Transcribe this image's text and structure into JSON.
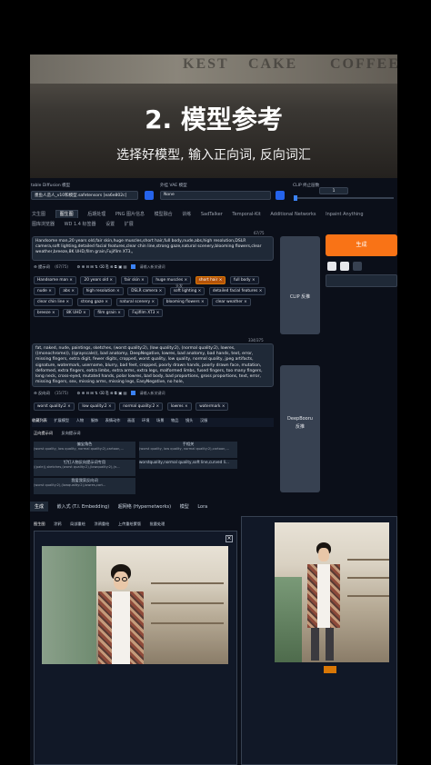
{
  "hero": {
    "sign_left": "KEST",
    "sign_mid": "CAKE",
    "sign_right": "COFFEE",
    "title": "2. 模型参考",
    "subtitle": "选择好模型, 输入正向词, 反向词汇"
  },
  "top": {
    "model_label": "table Diffusion 模型",
    "model_value": "墨鱼人造人_v10和模型.safetensors [ea6e802c]",
    "vae_label": "外挂 VAE 模型",
    "vae_value": "None",
    "clip_label": "CLIP 终止层数",
    "clip_value": "1"
  },
  "main_tabs": [
    "文生图",
    "图生图",
    "后期处理",
    "PNG 图片信息",
    "模型融合",
    "训练",
    "SadTalker",
    "Temporal-Kit",
    "Additional Networks",
    "Inpaint Anything"
  ],
  "main_tabs_row2": [
    "图库浏览器",
    "WD 1.4 标签器",
    "设置",
    "扩展"
  ],
  "prompt": {
    "text": "Handsome man,20 years old,fair skin,huge muscles,short hair,full body,nude,abs,high resolution,DSLR camera,soft lighting,detailed facial features,clear chin line,strong gaze,natural scenery,blooming flowers,clear weather,breeze,8K UHD,film grain,Fujifilm XT3,,",
    "counter": "67/75",
    "tags_label": "提示词",
    "tags_count": "(67/75)",
    "input_placeholder": "请输入新关键词",
    "tags": [
      "Handsome man",
      "20 years old",
      "fair skin",
      "huge muscles",
      "short hair",
      "full body",
      "nude",
      "abs",
      "high resolution",
      "DSLR camera",
      "soft lighting",
      "detailed facial features",
      "clear chin line",
      "strong gaze",
      "natural scenery",
      "blooming flowers",
      "clear weather",
      "breeze",
      "8K UHD",
      "film grain",
      "Fujifilm XT3"
    ],
    "highlight_tag": "short hair",
    "highlight_note": "头发"
  },
  "negative": {
    "text": "fat, naked, nude, paintings, sketches, (worst quality:2), (low quality:2), (normal quality:2), lowres, ((monochrome)), ((grayscale)), bad anatomy, DeepNegative, lowres, bad anatomy, bad hands, text, error, missing fingers, extra digit, fewer digits, cropped, worst quality, low quality, normal quality, jpeg artifacts, signature, watermark, username, blurry, bad feet, cropped, poorly drawn hands, poorly drawn face, mutation, deformed, extra fingers, extra limbs, extra arms, extra legs, malformed limbs, fused fingers, too many fingers, long neck, cross-eyed, mutated hands, polar lowres, bad body, bad proportions, gross proportions, text, error, missing fingers, sex, missing arms, missing legs, EasyNegative, no hole,",
    "counter": "334/375",
    "tags_label": "反向词",
    "tags_count": "(15/75)",
    "input_placeholder": "请输入新关键词",
    "tags": [
      "worst quality:2",
      "low quality:2",
      "normal quality:2",
      "lowres",
      "watermark"
    ]
  },
  "right": {
    "generate": "生成",
    "clip_button": "CLIP 反推",
    "deepbooru_button": "DeepBooru\n反推"
  },
  "category_tabs": [
    "收藏列表",
    "扩展模型",
    "人物",
    "服饰",
    "表情动作",
    "画面",
    "环境",
    "场景",
    "物品",
    "镜头",
    "汉服"
  ],
  "sub_tabs": [
    "正向提示词",
    "反向提示词"
  ],
  "presets": {
    "c1_title": "偏宝角色",
    "c1_desc": "(worst quality, low quality, normal quality:2),cartoon,...",
    "c2_title": "手相关",
    "c2_desc": "(worst quality, low quality, normal quality:2),cartoon,...",
    "c3_title": "钉钉人物反向提示词专用",
    "c3_desc": "((pale)),sketches,(worst quality:2),(lowquality:2),(n...",
    "c4_desc": "worstquality,normal quality,soft line,curved li...",
    "c5_title": "我爱我家反向词",
    "c5_desc": "(worst quality:2),(lowquality:2),lowres,cart..."
  },
  "bottom_tabs": [
    "生成",
    "嵌入式 (T.I. Embedding)",
    "超网络 (Hypernetworks)",
    "模型",
    "Lora"
  ],
  "img_tabs": [
    "图生图",
    "涂鸦",
    "局部重绘",
    "涂鸦重绘",
    "上传重绘蒙版",
    "批量处理"
  ],
  "close_icon": "×"
}
